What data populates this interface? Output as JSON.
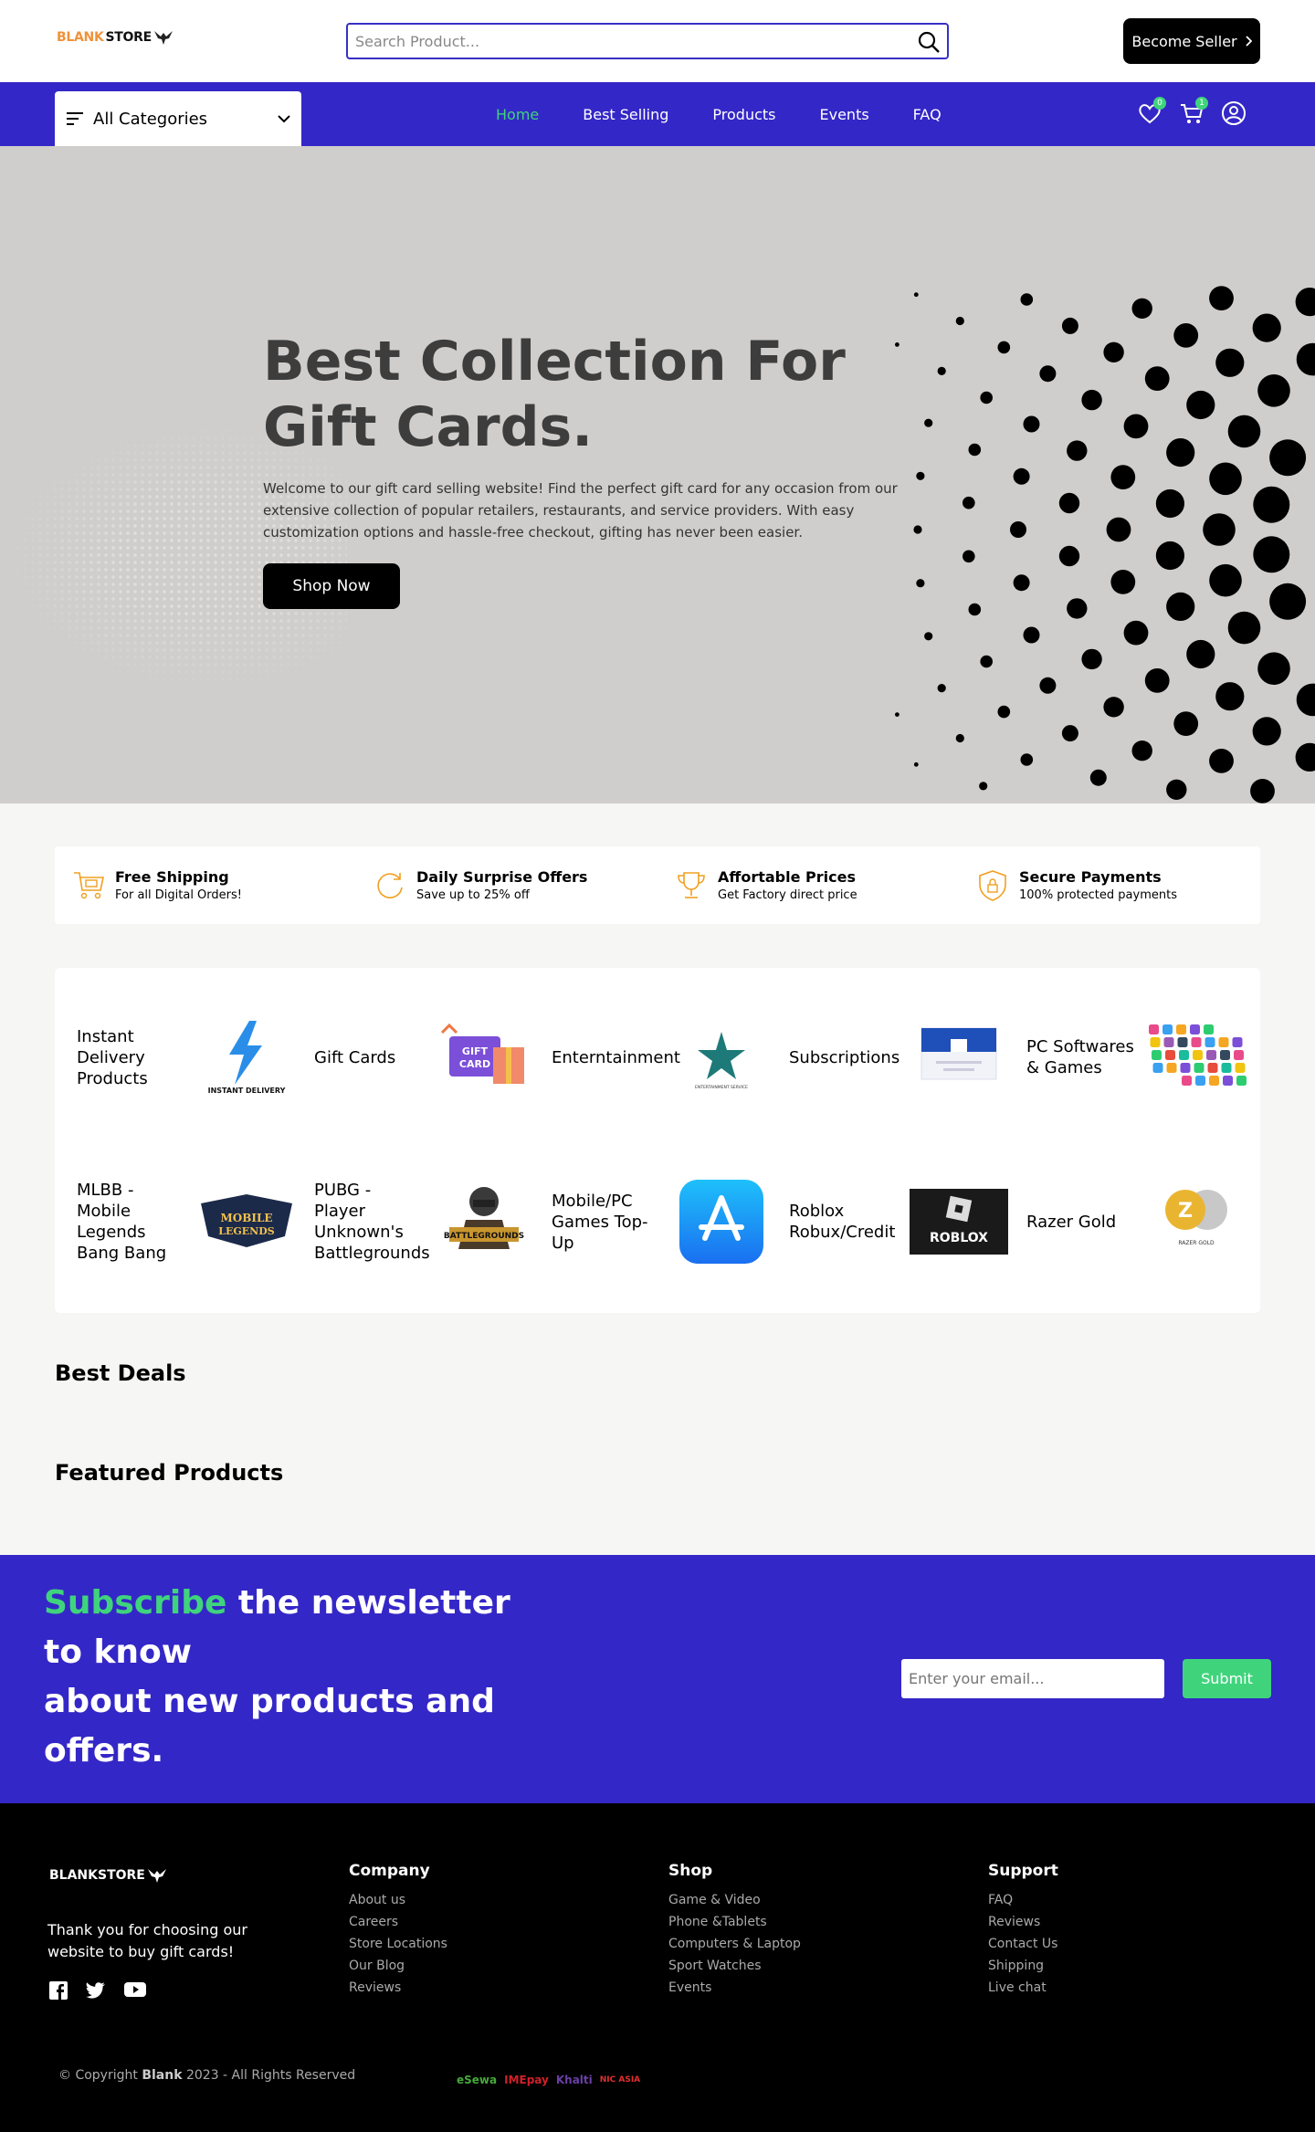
{
  "header": {
    "logo_part1": "BLANK",
    "logo_part2": "STORE",
    "search_placeholder": "Search Product...",
    "seller_label": "Become Seller"
  },
  "nav": {
    "categories_label": "All Categories",
    "links": [
      "Home",
      "Best Selling",
      "Products",
      "Events",
      "FAQ"
    ],
    "active": "Home",
    "wishlist_count": "0",
    "cart_count": "1"
  },
  "hero": {
    "title": "Best Collection For Gift Cards.",
    "description": "Welcome to our gift card selling website! Find the perfect gift card for any occasion from our extensive collection of popular retailers, restaurants, and service providers. With easy customization options and hassle-free checkout, gifting has never been easier.",
    "cta": "Shop Now"
  },
  "features": [
    {
      "title": "Free Shipping",
      "subtitle": "For all Digital Orders!",
      "icon": "cart-icon"
    },
    {
      "title": "Daily Surprise Offers",
      "subtitle": "Save up to 25% off",
      "icon": "refresh-icon"
    },
    {
      "title": "Affortable Prices",
      "subtitle": "Get Factory direct price",
      "icon": "trophy-icon"
    },
    {
      "title": "Secure Payments",
      "subtitle": "100% protected payments",
      "icon": "shield-lock-icon"
    }
  ],
  "categories": [
    {
      "name": "Instant Delivery Products",
      "thumb_text": "INSTANT DELIVERY"
    },
    {
      "name": "Gift Cards",
      "thumb_text": "GIFT CARD"
    },
    {
      "name": "Enterntainment",
      "thumb_text": "ENTERTAINMENT SERVICE"
    },
    {
      "name": "Subscriptions",
      "thumb_text": ""
    },
    {
      "name": "PC Softwares & Games",
      "thumb_text": ""
    },
    {
      "name": "MLBB - Mobile Legends Bang Bang",
      "thumb_text": "MOBILE LEGENDS"
    },
    {
      "name": "PUBG - Player Unknown's Battlegrounds",
      "thumb_text": "BATTLEGROUNDS"
    },
    {
      "name": "Mobile/PC Games Top-Up",
      "thumb_text": ""
    },
    {
      "name": "Roblox Robux/Credit",
      "thumb_text": "ROBLOX"
    },
    {
      "name": "Razer Gold",
      "thumb_text": "RAZER GOLD"
    }
  ],
  "sections": {
    "best_deals": "Best Deals",
    "featured": "Featured Products"
  },
  "newsletter": {
    "highlight": "Subscribe",
    "line1_rest": " the newsletter to know",
    "line2": "about new products and offers.",
    "email_placeholder": "Enter your email...",
    "submit": "Submit"
  },
  "footer": {
    "logo": "BLANKSTORE",
    "tagline": "Thank you for choosing our website to buy gift cards!",
    "columns": [
      {
        "heading": "Company",
        "links": [
          "About us",
          "Careers",
          "Store Locations",
          "Our Blog",
          "Reviews"
        ]
      },
      {
        "heading": "Shop",
        "links": [
          "Game & Video",
          "Phone &Tablets",
          "Computers & Laptop",
          "Sport Watches",
          "Events"
        ]
      },
      {
        "heading": "Support",
        "links": [
          "FAQ",
          "Reviews",
          "Contact Us",
          "Shipping",
          "Live chat"
        ]
      }
    ],
    "copyright_prefix": "© Copyright ",
    "copyright_brand": "Blank",
    "copyright_suffix": " 2023 - All Rights Reserved",
    "payments": [
      "eSewa",
      "IMEpay",
      "Khalti",
      "NIC ASIA"
    ]
  },
  "colors": {
    "brand_blue": "#3427c7",
    "accent_green": "#3fd47c",
    "logo_orange": "#f0923a"
  }
}
